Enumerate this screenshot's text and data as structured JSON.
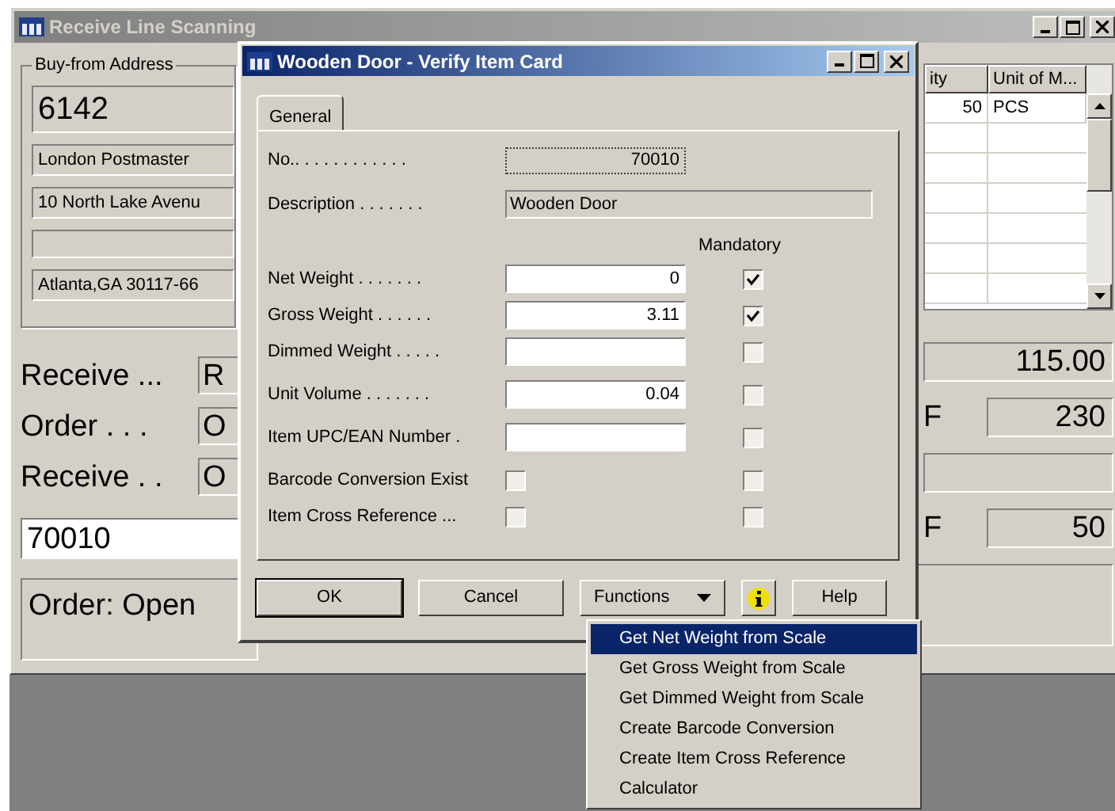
{
  "background_window": {
    "title": "Receive Line Scanning",
    "address": {
      "label": "Buy-from Address",
      "number": "6142",
      "lines": [
        {
          "kind": "text",
          "text": "London Postmaster"
        },
        {
          "kind": "text",
          "text": "10 North Lake Avenu"
        },
        {
          "kind": "blank"
        },
        {
          "kind": "text",
          "text": "Atlanta,GA  30117-66"
        }
      ]
    },
    "fields": [
      {
        "label": "Receive ...",
        "value": "R"
      },
      {
        "label": "Order . . .",
        "value": "O"
      },
      {
        "label": "Receive . .",
        "value": "O"
      }
    ],
    "scan_input": {
      "value": "70010"
    },
    "status": "Order: Open",
    "lines_table": {
      "columns": [
        "ity",
        "Unit of M..."
      ],
      "rows": [
        [
          "50",
          "PCS"
        ]
      ]
    },
    "totals": [
      {
        "kind": "value",
        "value": "115.00"
      },
      {
        "kind": "labeled",
        "label": "F",
        "value": "230"
      },
      {
        "kind": "blank"
      },
      {
        "kind": "labeled",
        "label": "F",
        "value": "50"
      }
    ]
  },
  "dialog": {
    "title": "Wooden Door - Verify Item Card",
    "tabs": [
      {
        "label": "General",
        "selected": true
      }
    ],
    "item": [
      {
        "kind": "id",
        "label": "No.. . . . . . . . . . . .",
        "value": "70010"
      },
      {
        "kind": "readonly",
        "label": "Description . . . . . . .",
        "value": "Wooden Door"
      }
    ],
    "mandatory_header": "Mandatory",
    "properties": [
      {
        "kind": "input",
        "label": "Net Weight . . . . . . .",
        "value": "0",
        "mandatory": true
      },
      {
        "kind": "input",
        "label": "Gross Weight . . . . . .",
        "value": "3.11",
        "mandatory": true
      },
      {
        "kind": "input",
        "label": "Dimmed Weight . . . . .",
        "mandatory": false
      },
      {
        "kind": "input",
        "label": "Unit Volume . . . . . . .",
        "value": "0.04",
        "mandatory": false
      },
      {
        "kind": "input",
        "label": "Item UPC/EAN Number  .",
        "mandatory": false
      },
      {
        "kind": "checkbox",
        "label": "Barcode Conversion Exist",
        "checked": false,
        "mandatory": false
      },
      {
        "kind": "checkbox",
        "label": "Item Cross Reference ...",
        "checked": false,
        "mandatory": false
      }
    ],
    "buttons": [
      {
        "kind": "button",
        "label": "OK",
        "default": true
      },
      {
        "kind": "button",
        "label": "Cancel",
        "default": false
      },
      {
        "kind": "menu",
        "label": "Functions"
      },
      {
        "kind": "info"
      },
      {
        "kind": "button",
        "label": "Help",
        "default": false
      }
    ]
  },
  "functions_menu": [
    {
      "label": "Get Net Weight from Scale",
      "selected": true
    },
    {
      "label": "Get Gross Weight from Scale",
      "selected": false
    },
    {
      "label": "Get Dimmed Weight from Scale",
      "selected": false
    },
    {
      "label": "Create Barcode Conversion",
      "selected": false
    },
    {
      "label": "Create Item Cross Reference",
      "selected": false
    },
    {
      "label": "Calculator",
      "selected": false
    }
  ]
}
